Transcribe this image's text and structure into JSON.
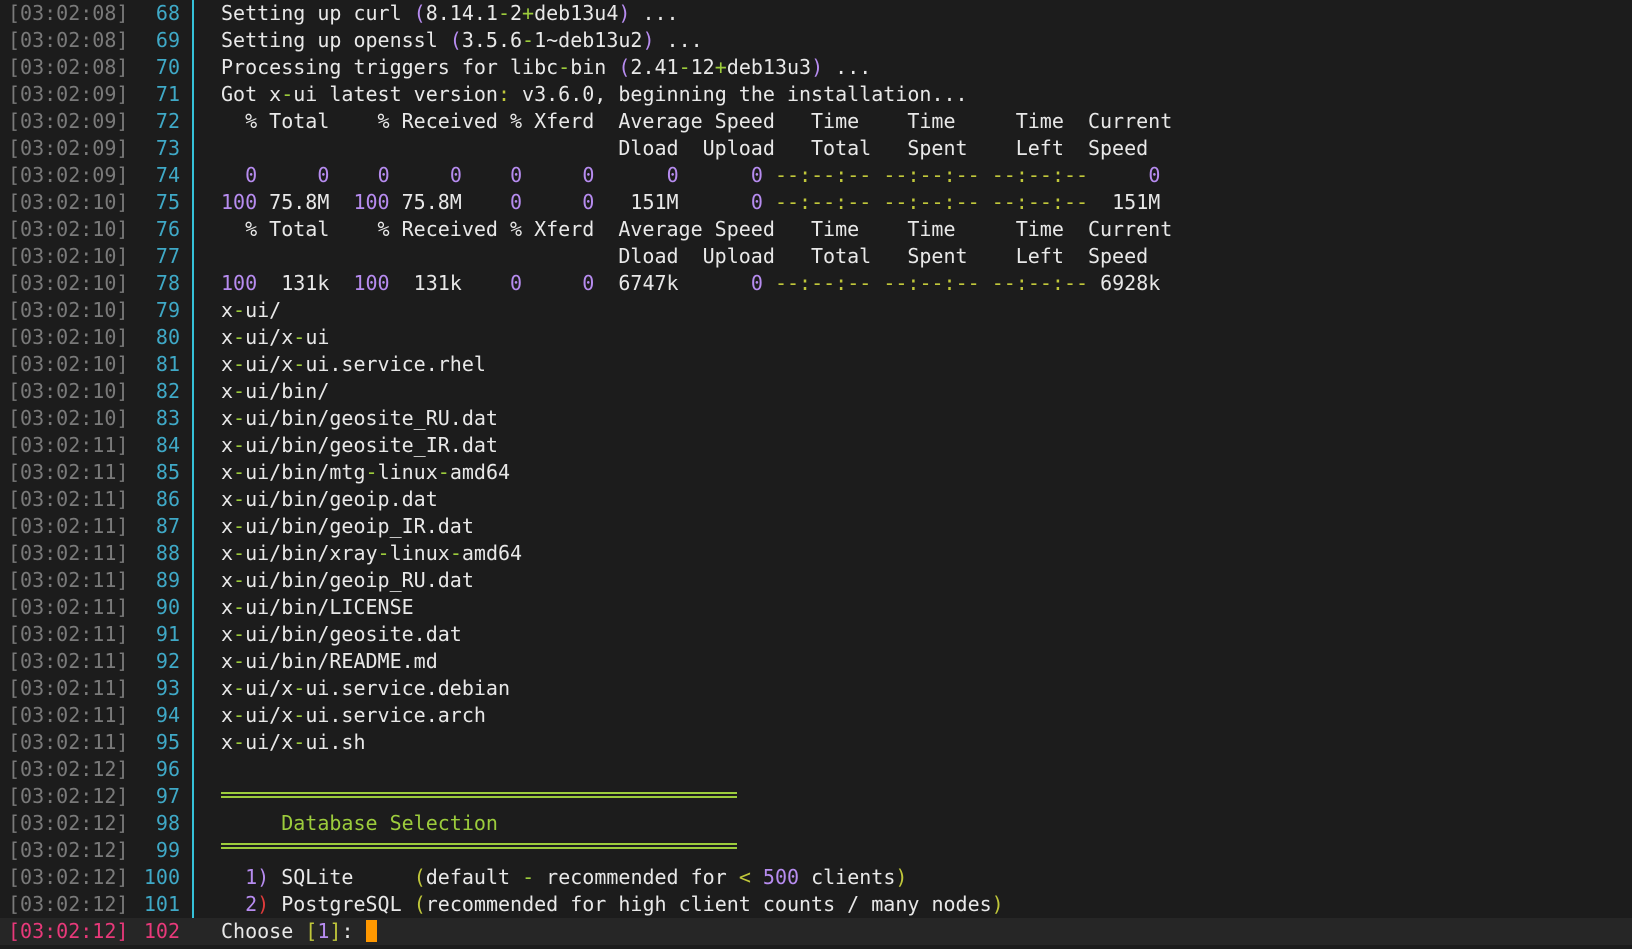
{
  "lines": [
    {
      "ts": "[03:02:08]",
      "ln": "68",
      "t1": "Setting up curl ",
      "v1": "(8.14.1-2+deb13u4)",
      "t2": " ..."
    },
    {
      "ts": "[03:02:08]",
      "ln": "69",
      "t1": "Setting up openssl ",
      "v1": "(3.5.6-1~deb13u2)",
      "t2": " ..."
    },
    {
      "ts": "[03:02:08]",
      "ln": "70",
      "t1": "Processing triggers for libc-bin ",
      "v1": "(2.41-12+deb13u3)",
      "t2": " ..."
    },
    {
      "ts": "[03:02:09]",
      "ln": "71",
      "t1": "Got x-ui latest version: v3.6.0, beginning the installation..."
    },
    {
      "ts": "[03:02:09]",
      "ln": "72",
      "t1": "  % Total    % Received % Xferd  Average Speed   Time    Time     Time  Current"
    },
    {
      "ts": "[03:02:09]",
      "ln": "73",
      "t1": "                                 Dload  Upload   Total   Spent    Left  Speed"
    },
    {
      "ts": "[03:02:09]",
      "ln": "74",
      "t1": "  0     0    0     0    0     0      0      0 --:--:-- --:--:-- --:--:--     0"
    },
    {
      "ts": "[03:02:10]",
      "ln": "75",
      "t1": "100 75.8M  100 75.8M    0     0   151M      0 --:--:-- --:--:-- --:--:--  151M"
    },
    {
      "ts": "[03:02:10]",
      "ln": "76",
      "t1": "  % Total    % Received % Xferd  Average Speed   Time    Time     Time  Current"
    },
    {
      "ts": "[03:02:10]",
      "ln": "77",
      "t1": "                                 Dload  Upload   Total   Spent    Left  Speed"
    },
    {
      "ts": "[03:02:10]",
      "ln": "78",
      "t1": "100  131k  100  131k    0     0  6747k      0 --:--:-- --:--:-- --:--:-- 6928k"
    },
    {
      "ts": "[03:02:10]",
      "ln": "79",
      "t1": "x-ui/"
    },
    {
      "ts": "[03:02:10]",
      "ln": "80",
      "t1": "x-ui/x-ui"
    },
    {
      "ts": "[03:02:10]",
      "ln": "81",
      "t1": "x-ui/x-ui.service.rhel"
    },
    {
      "ts": "[03:02:10]",
      "ln": "82",
      "t1": "x-ui/bin/"
    },
    {
      "ts": "[03:02:10]",
      "ln": "83",
      "t1": "x-ui/bin/geosite_RU.dat"
    },
    {
      "ts": "[03:02:11]",
      "ln": "84",
      "t1": "x-ui/bin/geosite_IR.dat"
    },
    {
      "ts": "[03:02:11]",
      "ln": "85",
      "t1": "x-ui/bin/mtg-linux-amd64"
    },
    {
      "ts": "[03:02:11]",
      "ln": "86",
      "t1": "x-ui/bin/geoip.dat"
    },
    {
      "ts": "[03:02:11]",
      "ln": "87",
      "t1": "x-ui/bin/geoip_IR.dat"
    },
    {
      "ts": "[03:02:11]",
      "ln": "88",
      "t1": "x-ui/bin/xray-linux-amd64"
    },
    {
      "ts": "[03:02:11]",
      "ln": "89",
      "t1": "x-ui/bin/geoip_RU.dat"
    },
    {
      "ts": "[03:02:11]",
      "ln": "90",
      "t1": "x-ui/bin/LICENSE"
    },
    {
      "ts": "[03:02:11]",
      "ln": "91",
      "t1": "x-ui/bin/geosite.dat"
    },
    {
      "ts": "[03:02:11]",
      "ln": "92",
      "t1": "x-ui/bin/README.md"
    },
    {
      "ts": "[03:02:11]",
      "ln": "93",
      "t1": "x-ui/x-ui.service.debian"
    },
    {
      "ts": "[03:02:11]",
      "ln": "94",
      "t1": "x-ui/x-ui.service.arch"
    },
    {
      "ts": "[03:02:11]",
      "ln": "95",
      "t1": "x-ui/x-ui.sh"
    },
    {
      "ts": "[03:02:12]",
      "ln": "96",
      "t1": ""
    },
    {
      "ts": "[03:02:12]",
      "ln": "97",
      "t1": ""
    },
    {
      "ts": "[03:02:12]",
      "ln": "98",
      "t1": "     Database Selection"
    },
    {
      "ts": "[03:02:12]",
      "ln": "99",
      "t1": ""
    },
    {
      "ts": "[03:02:12]",
      "ln": "100",
      "t1": "  1) SQLite     (default - recommended for < 500 clients)"
    },
    {
      "ts": "[03:02:12]",
      "ln": "101",
      "t1": "  2) PostgreSQL (recommended for high client counts / many nodes)"
    },
    {
      "ts": "[03:02:12]",
      "ln": "102",
      "t1": "Choose [1]: "
    }
  ]
}
